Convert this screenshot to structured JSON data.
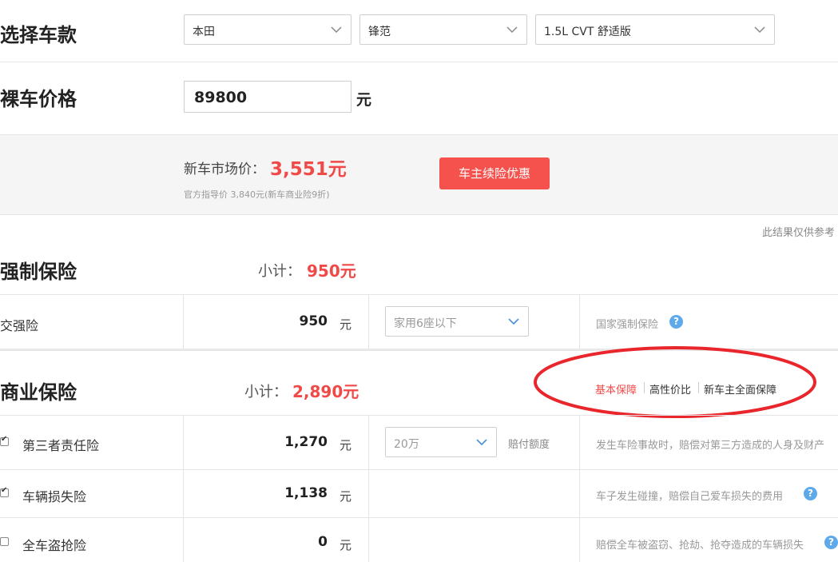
{
  "select_car": {
    "heading": "选择车款",
    "brand": "本田",
    "model": "锋范",
    "trim": "1.5L CVT 舒适版"
  },
  "bare_price": {
    "heading": "裸车价格",
    "value": "89800",
    "unit": "元"
  },
  "market": {
    "label": "新车市场价：",
    "value": "3,551元",
    "note": "官方指导价 3,840元(新车商业险9折)",
    "button": "车主续险优惠"
  },
  "disclaimer": "此结果仅供参考",
  "compulsory": {
    "heading": "强制保险",
    "subtotal_label": "小计：",
    "subtotal_value": "950元",
    "row": {
      "label": "交强险",
      "amount": "950",
      "unit": "元",
      "select": "家用6座以下",
      "desc": "国家强制保险"
    }
  },
  "commercial": {
    "heading": "商业保险",
    "subtotal_label": "小计：",
    "subtotal_value": "2,890元",
    "plans": [
      "基本保障",
      "高性价比",
      "新车主全面保障"
    ],
    "rows": [
      {
        "label": "第三者责任险",
        "amount": "1,270",
        "unit": "元",
        "checked": true,
        "select": "20万",
        "select_note": "赔付额度",
        "desc": "发生车险事故时，赔偿对第三方造成的人身及财产"
      },
      {
        "label": "车辆损失险",
        "amount": "1,138",
        "unit": "元",
        "checked": true,
        "desc": "车子发生碰撞，赔偿自己爱车损失的费用"
      },
      {
        "label": "全车盗抢险",
        "amount": "0",
        "unit": "元",
        "checked": false,
        "desc": "赔偿全车被盗窃、抢劫、抢夺造成的车辆损失"
      }
    ]
  },
  "colors": {
    "accent_red": "#f04a48",
    "button_red": "#f5514d",
    "help_blue": "#5ea9ea",
    "annotation_red": "#e8262b"
  }
}
